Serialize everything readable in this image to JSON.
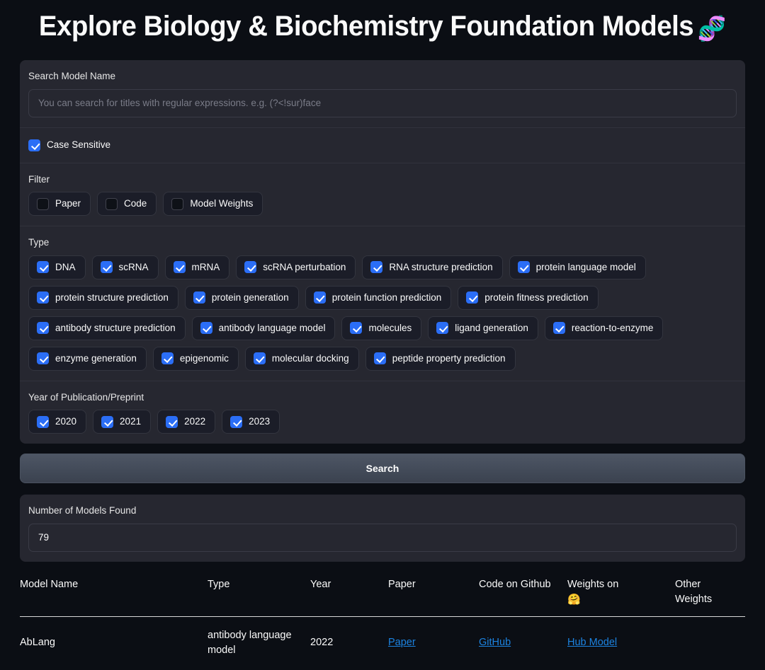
{
  "header": {
    "title": "Explore Biology & Biochemistry Foundation Models",
    "emoji": "🧬",
    "emoji_name": "dna-emoji"
  },
  "search": {
    "label": "Search Model Name",
    "placeholder": "You can search for titles with regular expressions. e.g. (?<!sur)face",
    "value": "",
    "case_sensitive": {
      "label": "Case Sensitive",
      "checked": true
    }
  },
  "filter": {
    "label": "Filter",
    "options": [
      {
        "label": "Paper",
        "checked": false
      },
      {
        "label": "Code",
        "checked": false
      },
      {
        "label": "Model Weights",
        "checked": false
      }
    ]
  },
  "type": {
    "label": "Type",
    "options": [
      {
        "label": "DNA",
        "checked": true
      },
      {
        "label": "scRNA",
        "checked": true
      },
      {
        "label": "mRNA",
        "checked": true
      },
      {
        "label": "scRNA perturbation",
        "checked": true
      },
      {
        "label": "RNA structure prediction",
        "checked": true
      },
      {
        "label": "protein language model",
        "checked": true
      },
      {
        "label": "protein structure prediction",
        "checked": true
      },
      {
        "label": "protein generation",
        "checked": true
      },
      {
        "label": "protein function prediction",
        "checked": true
      },
      {
        "label": "protein fitness prediction",
        "checked": true
      },
      {
        "label": "antibody structure prediction",
        "checked": true
      },
      {
        "label": "antibody language model",
        "checked": true
      },
      {
        "label": "molecules",
        "checked": true
      },
      {
        "label": "ligand generation",
        "checked": true
      },
      {
        "label": "reaction-to-enzyme",
        "checked": true
      },
      {
        "label": "enzyme generation",
        "checked": true
      },
      {
        "label": "epigenomic",
        "checked": true
      },
      {
        "label": "molecular docking",
        "checked": true
      },
      {
        "label": "peptide property prediction",
        "checked": true
      }
    ]
  },
  "year": {
    "label": "Year of Publication/Preprint",
    "options": [
      {
        "label": "2020",
        "checked": true
      },
      {
        "label": "2021",
        "checked": true
      },
      {
        "label": "2022",
        "checked": true
      },
      {
        "label": "2023",
        "checked": true
      }
    ]
  },
  "search_button": {
    "label": "Search"
  },
  "results": {
    "label": "Number of Models Found",
    "value": "79"
  },
  "table": {
    "columns": [
      "Model Name",
      "Type",
      "Year",
      "Paper",
      "Code on Github",
      "Weights on 🤗",
      "Other Weights"
    ],
    "weights_header_text": "Weights on",
    "weights_header_emoji": "🤗",
    "rows": [
      {
        "name": "AbLang",
        "type": "antibody language model",
        "year": "2022",
        "paper": "Paper",
        "code": "GitHub",
        "weights": "Hub Model",
        "other": ""
      }
    ]
  },
  "colors": {
    "background": "#0b0e14",
    "panel": "#262730",
    "accent_checkbox": "#2b6ef6",
    "link": "#1c83e1",
    "text": "#fafafa"
  }
}
